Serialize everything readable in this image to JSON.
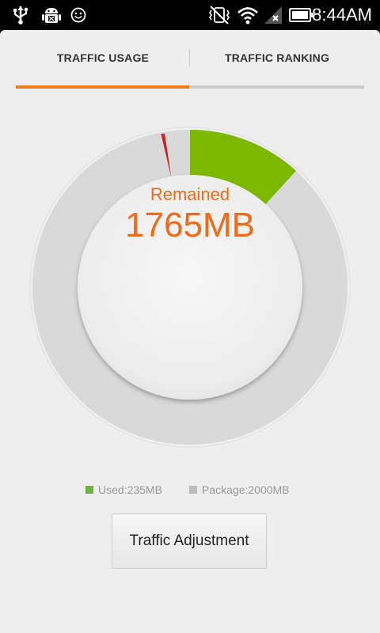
{
  "status_bar": {
    "time": "8:44AM",
    "icons": [
      "usb-icon",
      "android-debug-icon",
      "smiley-icon",
      "mute-vibrate-icon",
      "wifi-icon",
      "no-signal-icon",
      "battery-icon"
    ]
  },
  "tabs": [
    {
      "label": "TRAFFIC USAGE",
      "selected": true
    },
    {
      "label": "TRAFFIC RANKING",
      "selected": false
    }
  ],
  "colors": {
    "accent": "#ee7d1c",
    "used": "#7db800",
    "package": "#bbbbbb",
    "needle": "#c0262a"
  },
  "gauge": {
    "remained_label": "Remained",
    "remained_value": "1765MB",
    "used_mb": 235,
    "package_mb": 2000
  },
  "legend": {
    "used": "Used:235MB",
    "package": "Package:2000MB"
  },
  "button": {
    "label": "Traffic Adjustment"
  }
}
